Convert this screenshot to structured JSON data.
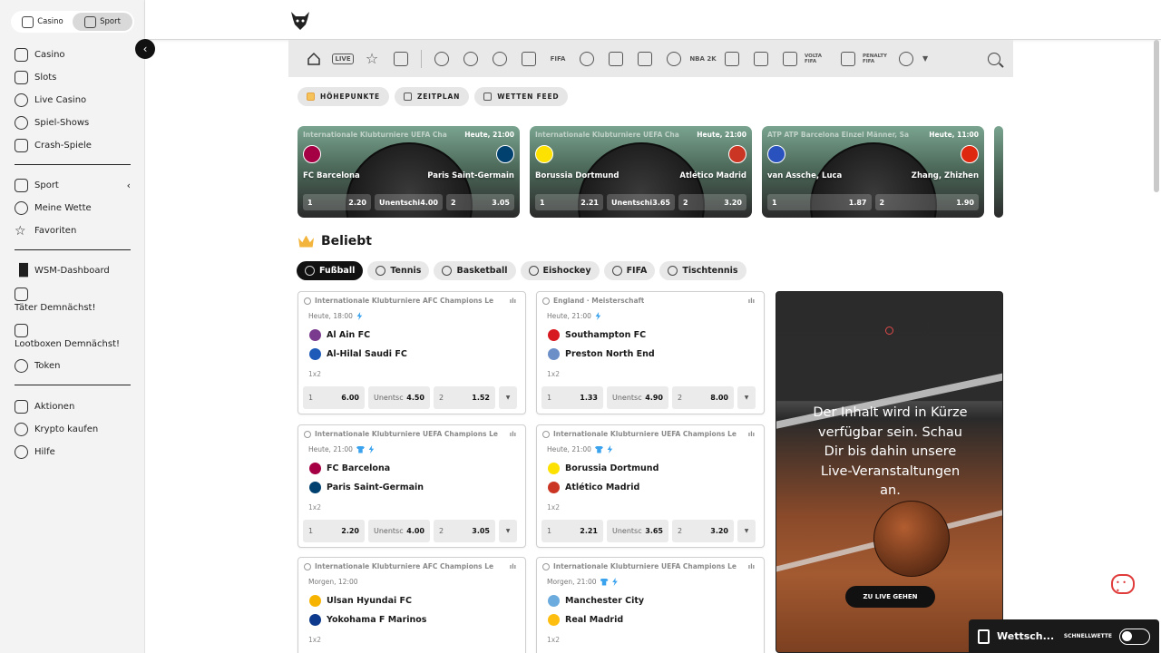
{
  "modes": {
    "casino": "Casino",
    "sport": "Sport"
  },
  "sidebar": {
    "group1": [
      "Casino",
      "Slots",
      "Live Casino",
      "Spiel-Shows",
      "Crash-Spiele"
    ],
    "group2": [
      "Sport",
      "Meine Wette",
      "Favoriten"
    ],
    "group3": [
      "WSM-Dashboard",
      "Täter Demnächst!",
      "Lootboxen Demnächst!",
      "Token"
    ],
    "group4": [
      "Aktionen",
      "Krypto kaufen",
      "Hilfe"
    ]
  },
  "sportnav": {
    "live_label": "LIVE",
    "fifa_labels": [
      "FIFA",
      "NBA 2K",
      "VOLTA FIFA",
      "PENALTY FIFA"
    ]
  },
  "viewtabs": [
    "HÖHEPUNKTE",
    "ZEITPLAN",
    "WETTEN FEED"
  ],
  "highlights": [
    {
      "comp": "Internationale Klubturniere UEFA Cha",
      "time": "Heute, 21:00",
      "home": "FC Barcelona",
      "away": "Paris Saint-Germain",
      "o1l": "1",
      "o1": "2.20",
      "oxl": "Unentschi",
      "ox": "4.00",
      "o2l": "2",
      "o2": "3.05",
      "homeColor": "#a50044",
      "awayColor": "#004170"
    },
    {
      "comp": "Internationale Klubturniere UEFA Cha",
      "time": "Heute, 21:00",
      "home": "Borussia Dortmund",
      "away": "Atlético Madrid",
      "o1l": "1",
      "o1": "2.21",
      "oxl": "Unentschi",
      "ox": "3.65",
      "o2l": "2",
      "o2": "3.20",
      "homeColor": "#fde100",
      "awayColor": "#cb3524"
    },
    {
      "comp": "ATP ATP Barcelona Einzel Männer, Sa",
      "time": "Heute, 11:00",
      "home": "van Assche, Luca",
      "away": "Zhang, Zhizhen",
      "o1l": "1",
      "o1": "1.87",
      "oxl": "",
      "ox": "",
      "o2l": "2",
      "o2": "1.90",
      "homeColor": "#2a52be",
      "awayColor": "#de2910"
    }
  ],
  "beliebt": "Beliebt",
  "sporttabs": [
    "Fußball",
    "Tennis",
    "Basketball",
    "Eishockey",
    "FIFA",
    "Tischtennis"
  ],
  "matches": [
    {
      "comp": "Internationale Klubturniere AFC Champions Le",
      "time": "Heute, 18:00",
      "home": "Al Ain FC",
      "away": "Al-Hilal Saudi FC",
      "market": "1x2",
      "o1": "6.00",
      "oxl": "Unentsc",
      "ox": "4.50",
      "o2": "1.52",
      "hc": "#7a3b8f",
      "ac": "#1e5bb8",
      "icons": [
        "bolt"
      ]
    },
    {
      "comp": "England · Meisterschaft",
      "time": "Heute, 21:00",
      "home": "Southampton FC",
      "away": "Preston North End",
      "market": "1x2",
      "o1": "1.33",
      "oxl": "Unentsc",
      "ox": "4.90",
      "o2": "8.00",
      "hc": "#d71920",
      "ac": "#6d8fc8",
      "icons": [
        "bolt"
      ]
    },
    {
      "comp": "Internationale Klubturniere UEFA Champions Le",
      "time": "Heute, 21:00",
      "home": "FC Barcelona",
      "away": "Paris Saint-Germain",
      "market": "1x2",
      "o1": "2.20",
      "oxl": "Unentsc",
      "ox": "4.00",
      "o2": "3.05",
      "hc": "#a50044",
      "ac": "#004170",
      "icons": [
        "shirt",
        "bolt"
      ]
    },
    {
      "comp": "Internationale Klubturniere UEFA Champions Le",
      "time": "Heute, 21:00",
      "home": "Borussia Dortmund",
      "away": "Atlético Madrid",
      "market": "1x2",
      "o1": "2.21",
      "oxl": "Unentsc",
      "ox": "3.65",
      "o2": "3.20",
      "hc": "#fde100",
      "ac": "#cb3524",
      "icons": [
        "shirt",
        "bolt"
      ]
    },
    {
      "comp": "Internationale Klubturniere AFC Champions Le",
      "time": "Morgen, 12:00",
      "home": "Ulsan Hyundai FC",
      "away": "Yokohama F Marinos",
      "market": "1x2",
      "o1": "",
      "oxl": "",
      "ox": "",
      "o2": "",
      "hc": "#f6b300",
      "ac": "#0d3a8c",
      "icons": []
    },
    {
      "comp": "Internationale Klubturniere UEFA Champions Le",
      "time": "Morgen, 21:00",
      "home": "Manchester City",
      "away": "Real Madrid",
      "market": "1x2",
      "o1": "",
      "oxl": "",
      "ox": "",
      "o2": "",
      "hc": "#6cabdd",
      "ac": "#febe10",
      "icons": [
        "shirt",
        "bolt"
      ]
    }
  ],
  "live": {
    "message": "Der Inhalt wird in Kürze verfügbar sein. Schau Dir bis dahin unsere Live-Veranstaltungen an.",
    "button": "ZU LIVE GEHEN"
  },
  "betslip": {
    "label": "Wettsch...",
    "switch": "SCHNELLWETTE"
  }
}
